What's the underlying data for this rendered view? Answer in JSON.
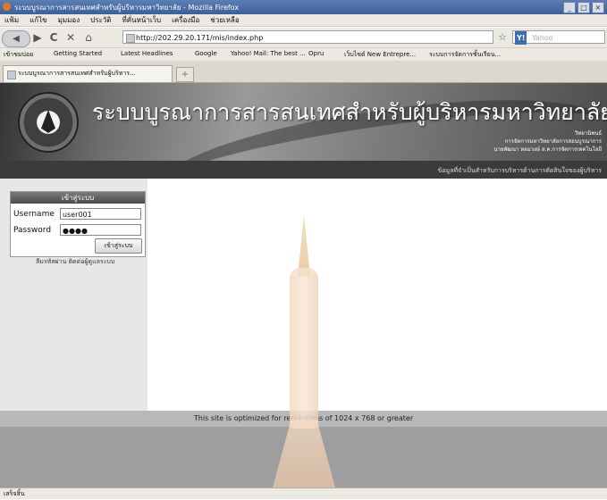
{
  "window": {
    "title": "ระบบบูรณาการสารสนเทศสำหรับผู้บริหารมหาวิทยาลัย - Mozilla Firefox",
    "controls": [
      "_",
      "□",
      "×"
    ]
  },
  "menu": [
    "แฟ้ม",
    "แก้ไข",
    "มุมมอง",
    "ประวัติ",
    "ที่คั่นหน้าเว็บ",
    "เครื่องมือ",
    "ช่วยเหลือ"
  ],
  "nav": {
    "back_icon": "◀",
    "forward_icon": "▶",
    "reload_icon": "C",
    "stop_icon": "✕",
    "home_icon": "⌂",
    "url": "http://202.29.20.171/mis/index.php",
    "star_icon": "☆",
    "search_engine": "Y!",
    "search_placeholder": "Yahoo"
  },
  "bookmarks": [
    "เข้าชมบ่อย",
    "Getting Started",
    "Latest Headlines",
    "Google",
    "Yahoo! Mail: The best ...",
    "Opru",
    "เว็บไซต์ New Entrepre...",
    "ระบบการจัดการชั้นเรียน..."
  ],
  "tab": {
    "label": "ระบบบูรณาการสารสนเทศสำหรับผู้บริหาร...",
    "new_tab": "+"
  },
  "banner": {
    "title": "ระบบบูรณาการสารสนเทศสำหรับผู้บริหารมหาวิทยาลัย",
    "info": [
      "วิทยานิพนธ์",
      "การจัดการมหาวิทยาลัยการสอนบูรณาการ",
      "นายพัฒนา หอมวงษ์ ส.ค.การจัดการเทคโนโลยี"
    ]
  },
  "infobar": {
    "text": "ข้อมูลที่จำเป็นสำหรับการบริหารด้านการตัดสินใจของผู้บริหาร"
  },
  "login": {
    "header": "เข้าสู่ระบบ",
    "username_label": "Username",
    "username_value": "user001",
    "password_label": "Password",
    "password_value": "●●●●",
    "submit_label": "เข้าสู่ระบบ",
    "register_text": "ลืมรหัสผ่าน ติดต่อผู้ดูแลระบบ"
  },
  "footer": {
    "message": "This site is optimized for resolutions of 1024 x 768 or greater"
  },
  "status": {
    "text": "เสร็จสิ้น"
  }
}
